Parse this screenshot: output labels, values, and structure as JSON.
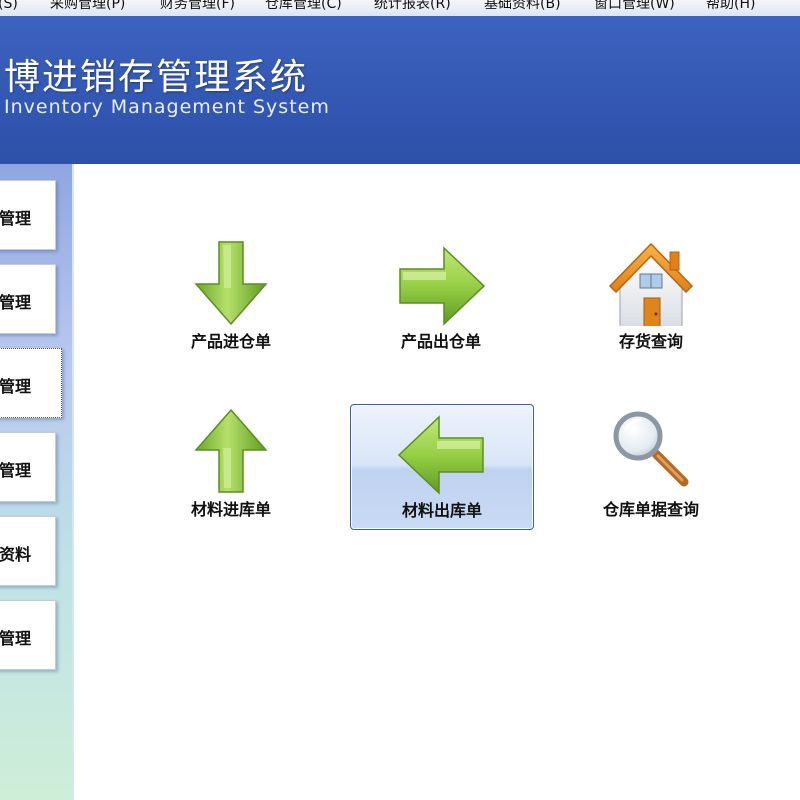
{
  "menubar": {
    "items": [
      {
        "label": "(S)"
      },
      {
        "label": "采购管理(P)"
      },
      {
        "label": "财务管理(F)"
      },
      {
        "label": "仓库管理(C)"
      },
      {
        "label": "统计报表(R)"
      },
      {
        "label": "基础资料(B)"
      },
      {
        "label": "窗口管理(W)"
      },
      {
        "label": "帮助(H)"
      }
    ]
  },
  "banner": {
    "title": "博进销存管理系统",
    "subtitle": "Inventory Management System"
  },
  "sidebar": {
    "items": [
      {
        "label": "管理"
      },
      {
        "label": "管理"
      },
      {
        "label": "管理"
      },
      {
        "label": "管理"
      },
      {
        "label": "资料"
      },
      {
        "label": "管理"
      }
    ]
  },
  "tiles": [
    {
      "label": "产品进仓单",
      "icon": "arrow-down-icon"
    },
    {
      "label": "产品出仓单",
      "icon": "arrow-right-icon"
    },
    {
      "label": "存货查询",
      "icon": "house-icon"
    },
    {
      "label": "材料进库单",
      "icon": "arrow-up-icon"
    },
    {
      "label": "材料出库单",
      "icon": "arrow-left-icon",
      "selected": true
    },
    {
      "label": "仓库单据查询",
      "icon": "magnifier-icon"
    }
  ],
  "colors": {
    "banner": "#3358b4",
    "arrow_green": "#8cc63f",
    "selection_border": "#3c5ea8"
  }
}
